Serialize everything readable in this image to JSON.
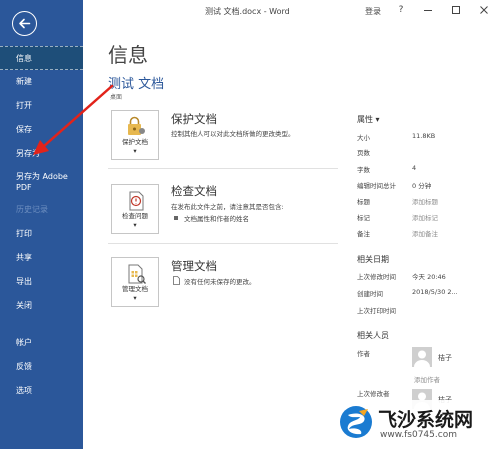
{
  "titlebar": {
    "doc_title": "测试 文档.docx  -  Word",
    "login": "登录",
    "help": "?",
    "controls": [
      "minimize-icon",
      "restore-icon",
      "close-icon"
    ]
  },
  "sidebar": {
    "back_icon": "back-arrow-icon",
    "items": [
      {
        "label": "信息",
        "state": "active"
      },
      {
        "label": "新建"
      },
      {
        "label": "打开"
      },
      {
        "label": "保存"
      },
      {
        "label": "另存为"
      },
      {
        "label": "另存为 Adobe PDF"
      },
      {
        "label": "历史记录",
        "state": "disabled"
      },
      {
        "label": "打印"
      },
      {
        "label": "共享"
      },
      {
        "label": "导出"
      },
      {
        "label": "关闭"
      },
      {
        "label": "帐户"
      },
      {
        "label": "反馈"
      },
      {
        "label": "选项"
      }
    ]
  },
  "main": {
    "page_title": "信息",
    "doc_name": "测试 文档",
    "doc_location": "桌面",
    "cards": [
      {
        "button_label": "保护文档",
        "icon": "lock-document-icon",
        "title": "保护文档",
        "description": "控制其他人可以对此文档所做的更改类型。"
      },
      {
        "button_label": "检查问题",
        "icon": "inspect-document-icon",
        "title": "检查文档",
        "description": "在发布此文件之前，请注意其是否包含:",
        "bullets": [
          "文档属性和作者的姓名"
        ]
      },
      {
        "button_label": "管理文档",
        "icon": "manage-document-icon",
        "title": "管理文档",
        "description": "没有任何未保存的更改。",
        "desc_icon": "document-icon"
      }
    ]
  },
  "properties": {
    "header": "属性",
    "items": [
      {
        "label": "大小",
        "value": "11.8KB"
      },
      {
        "label": "页数",
        "value": ""
      },
      {
        "label": "字数",
        "value": "4"
      },
      {
        "label": "编辑时间总计",
        "value": "0 分钟"
      },
      {
        "label": "标题",
        "value": "添加标题",
        "placeholder": true
      },
      {
        "label": "标记",
        "value": "添加标记",
        "placeholder": true
      },
      {
        "label": "备注",
        "value": "添加备注",
        "placeholder": true
      }
    ],
    "dates_title": "相关日期",
    "dates": [
      {
        "label": "上次修改时间",
        "value": "今天 20:46"
      },
      {
        "label": "创建时间",
        "value": "2018/5/30 2..."
      },
      {
        "label": "上次打印时间",
        "value": ""
      }
    ],
    "people_title": "相关人员",
    "author_label": "作者",
    "author_name": "桔子",
    "add_author": "添加作者",
    "last_modified_by_label": "上次修改者",
    "last_modified_by_name": "桔子"
  },
  "watermark": {
    "title": "飞沙系统网",
    "url": "www.fs0745.com"
  },
  "colors": {
    "sidebar": "#2b579a",
    "sidebar_active": "#1e4e79",
    "accent_text": "#2b579a",
    "annotation_arrow": "#e2231a"
  }
}
